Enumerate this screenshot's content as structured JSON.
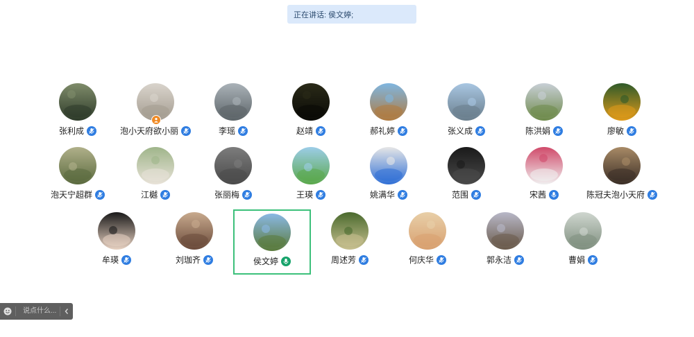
{
  "banner": {
    "text": "正在讲话: 侯文婷;"
  },
  "participants": [
    {
      "name": "张利成",
      "mic": "normal",
      "palette": [
        "#7f8c6a",
        "#2e3b2a"
      ]
    },
    {
      "name": "泡小天府欲小丽",
      "mic": "normal",
      "palette": [
        "#d9d4cc",
        "#a49c90"
      ],
      "host": true
    },
    {
      "name": "李瑶",
      "mic": "normal",
      "palette": [
        "#aab2b8",
        "#5c6468"
      ]
    },
    {
      "name": "赵靖",
      "mic": "normal",
      "palette": [
        "#2a2a18",
        "#0a0a06"
      ]
    },
    {
      "name": "郝礼婷",
      "mic": "normal",
      "palette": [
        "#7fb6e0",
        "#b07a3e"
      ]
    },
    {
      "name": "张义成",
      "mic": "normal",
      "palette": [
        "#a8c6e2",
        "#6a7e8c"
      ]
    },
    {
      "name": "陈洪娟",
      "mic": "normal",
      "palette": [
        "#c8cfd6",
        "#6e8a4a"
      ]
    },
    {
      "name": "廖敏",
      "mic": "normal",
      "palette": [
        "#2f5a2a",
        "#e09a1a"
      ]
    },
    {
      "name": "泡天宁超群",
      "mic": "normal",
      "palette": [
        "#b0b08a",
        "#5a6a3e"
      ]
    },
    {
      "name": "江樾",
      "mic": "normal",
      "palette": [
        "#9fb58a",
        "#e8e2d8"
      ]
    },
    {
      "name": "张丽梅",
      "mic": "normal",
      "palette": [
        "#7c7c7c",
        "#4a4a4a"
      ]
    },
    {
      "name": "王瑛",
      "mic": "normal",
      "palette": [
        "#9ccde8",
        "#5aa84a"
      ]
    },
    {
      "name": "姚满华",
      "mic": "normal",
      "palette": [
        "#e6e6e6",
        "#2f6fd6"
      ]
    },
    {
      "name": "范围",
      "mic": "normal",
      "palette": [
        "#1a1a1a",
        "#4a4a4a"
      ]
    },
    {
      "name": "宋茜",
      "mic": "muted",
      "palette": [
        "#d04a6a",
        "#f0f0f0"
      ]
    },
    {
      "name": "陈冠夫泡小天府",
      "mic": "normal",
      "palette": [
        "#a88a66",
        "#3a2e26"
      ]
    },
    {
      "name": "牟瑛",
      "mic": "normal",
      "palette": [
        "#1a1a1a",
        "#e8d2c2"
      ]
    },
    {
      "name": "刘珈齐",
      "mic": "normal",
      "palette": [
        "#c8aa8e",
        "#6a4a3a"
      ]
    },
    {
      "name": "侯文婷",
      "mic": "speaking",
      "palette": [
        "#8ab8e4",
        "#5a7a3a"
      ],
      "active": true
    },
    {
      "name": "周述芳",
      "mic": "normal",
      "palette": [
        "#4a6a2e",
        "#c8c090"
      ]
    },
    {
      "name": "何庆华",
      "mic": "normal",
      "palette": [
        "#e8cfa8",
        "#d8a070"
      ]
    },
    {
      "name": "郭永洁",
      "mic": "normal",
      "palette": [
        "#b8b8c8",
        "#6a5a4a"
      ]
    },
    {
      "name": "曹娟",
      "mic": "normal",
      "palette": [
        "#cfd6cf",
        "#7f8f7f"
      ]
    }
  ],
  "chat": {
    "placeholder": "说点什么..."
  }
}
